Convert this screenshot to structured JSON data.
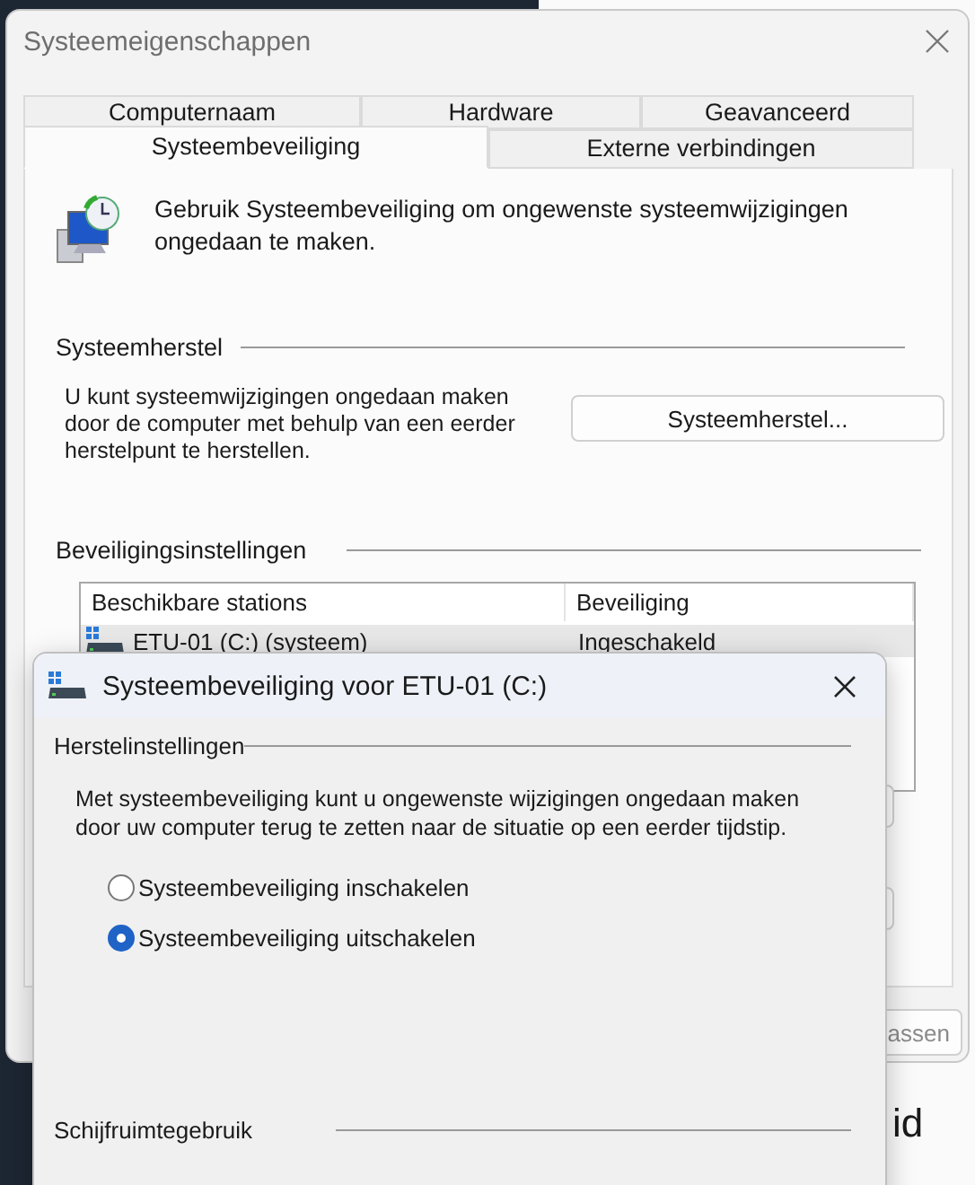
{
  "background_window": {
    "heading_fragment": "id"
  },
  "window": {
    "title": "Systeemeigenschappen"
  },
  "tab_rows": [
    {
      "tabs": [
        {
          "label": "Computernaam",
          "selected": false
        },
        {
          "label": "Hardware",
          "selected": false
        },
        {
          "label": "Geavanceerd",
          "selected": false
        }
      ]
    },
    {
      "tabs": [
        {
          "label": "Systeembeveiliging",
          "selected": true
        },
        {
          "label": "Externe verbindingen",
          "selected": false
        }
      ]
    }
  ],
  "intro": "Gebruik Systeembeveiliging om ongewenste systeemwijzigingen ongedaan te maken.",
  "restore": {
    "heading": "Systeemherstel",
    "text": "U kunt systeemwijzigingen ongedaan maken door de computer met behulp van een eerder herstelpunt te herstellen.",
    "button": "Systeemherstel..."
  },
  "protection": {
    "heading": "Beveiligingsinstellingen",
    "columns": [
      "Beschikbare stations",
      "Beveiliging"
    ],
    "rows": [
      {
        "drive": "ETU-01 (C:) (systeem)",
        "protection": "Ingeschakeld",
        "selected": true
      }
    ]
  },
  "footer_buttons": [
    "assen"
  ],
  "dialog": {
    "title": "Systeembeveiliging voor ETU-01 (C:)",
    "restore_settings": {
      "heading": "Herstelinstellingen",
      "text": "Met systeembeveiliging kunt u ongewenste wijzigingen ongedaan maken door uw computer terug te zetten naar de situatie op een eerder tijdstip.",
      "options": [
        {
          "label": "Systeembeveiliging inschakelen",
          "selected": false
        },
        {
          "label": "Systeembeveiliging uitschakelen",
          "selected": true
        }
      ]
    },
    "disk_usage": {
      "heading": "Schijfruimtegebruik"
    }
  }
}
